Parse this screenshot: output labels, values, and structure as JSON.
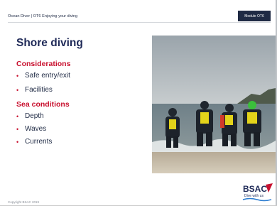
{
  "header": {
    "course": "Ocean Diver | OT6 Enjoying your diving",
    "module_tag": "Module OT6"
  },
  "slide": {
    "title": "Shore diving",
    "sections": [
      {
        "heading": "Considerations",
        "items": [
          "Safe entry/exit",
          "Facilities"
        ]
      },
      {
        "heading": "Sea conditions",
        "items": [
          "Depth",
          "Waves",
          "Currents"
        ]
      }
    ]
  },
  "footer": {
    "copyright": "Copyright BSAC 2019"
  },
  "logo": {
    "text": "BSAC",
    "tagline": "Dive with us"
  },
  "colors": {
    "navy": "#1f2a58",
    "red": "#c8102e"
  }
}
